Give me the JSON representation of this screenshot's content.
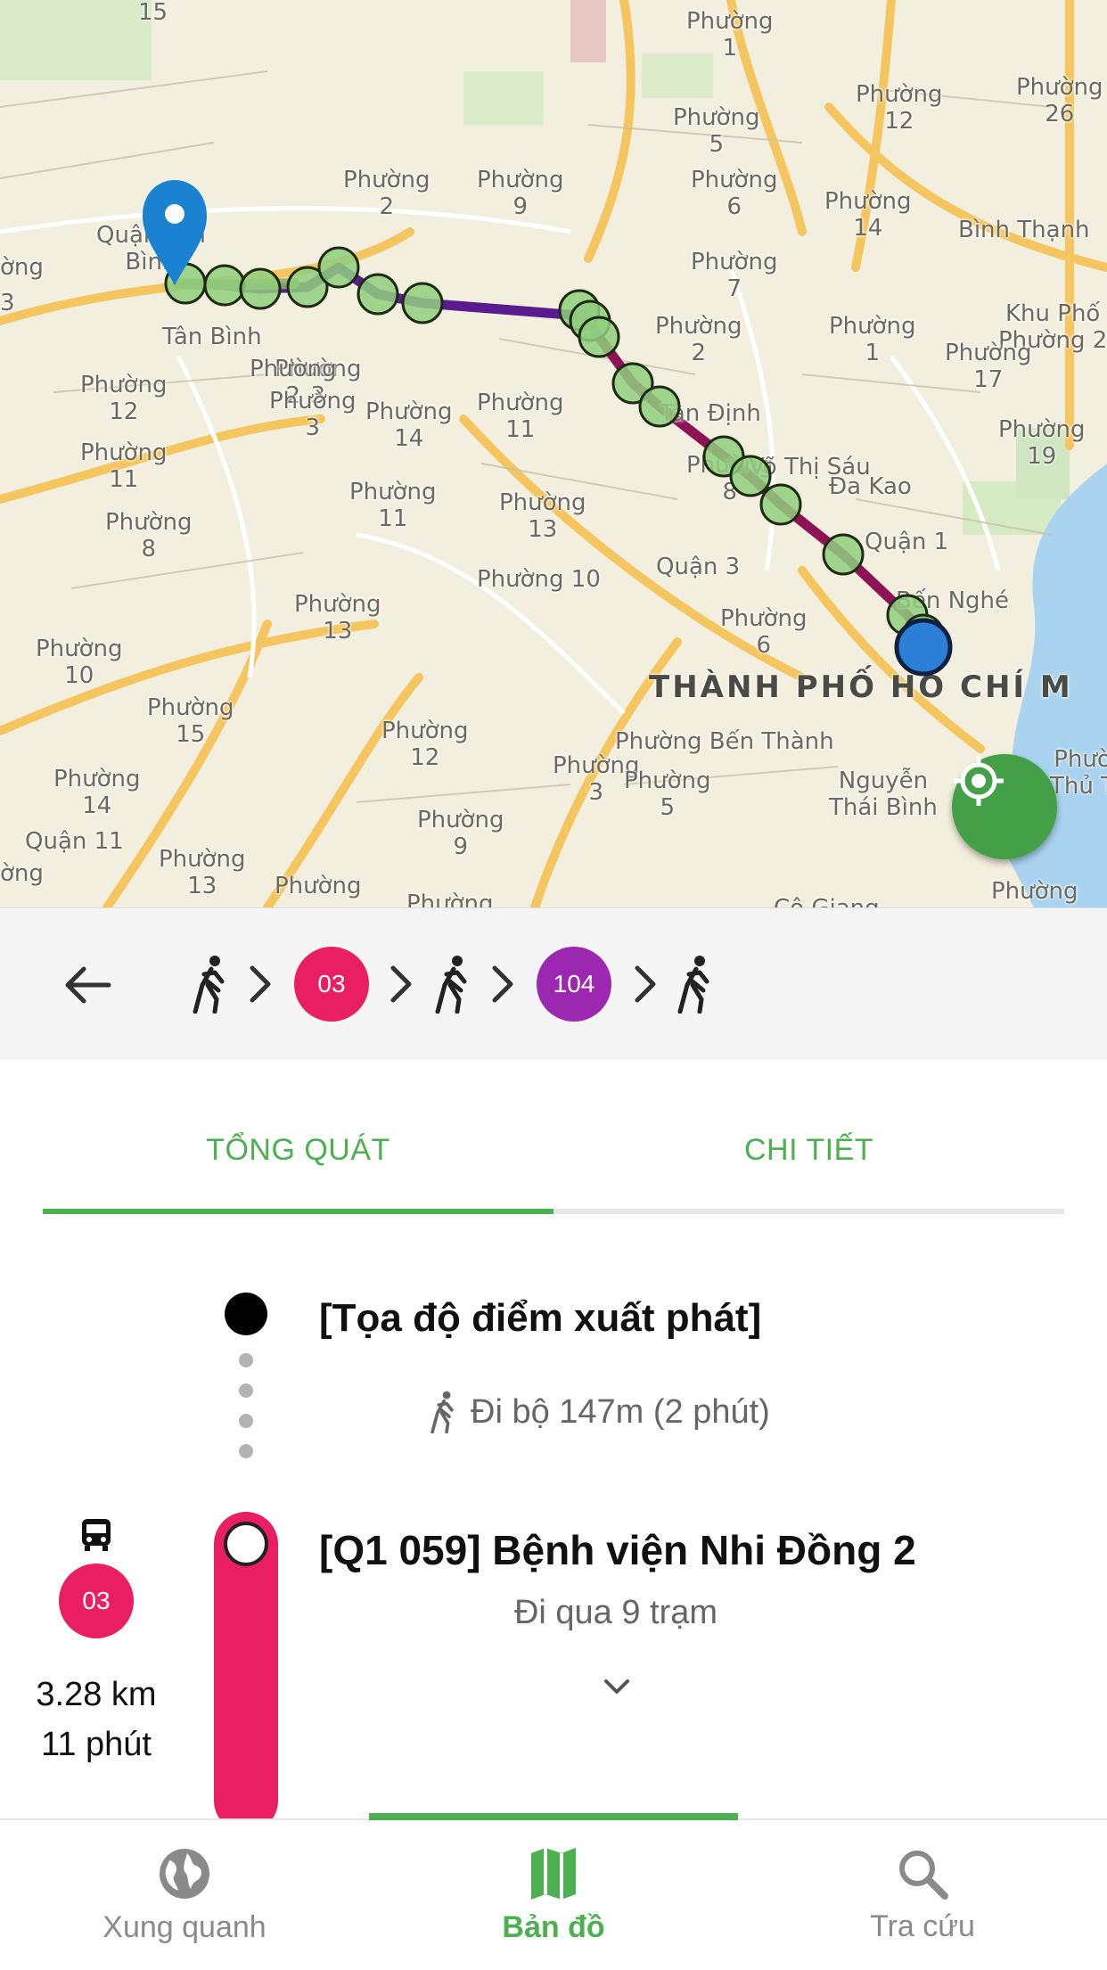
{
  "map": {
    "labels": [
      "15",
      "Phường\n1",
      "Phường\n12",
      "Phường\n26",
      "Phường\n5",
      "Phường\n2",
      "Phường\n9",
      "Phường\n6",
      "Phường\n14",
      "Bình Thạnh",
      "Quận Tân\nBình",
      "ờng",
      "3",
      "Tân Bình",
      "Phường\n3",
      "Phường\n7",
      "Khu Phố\nPhường 2",
      "Phường\n2",
      "Phường\n1",
      "Phường\n17",
      "Phường\n12",
      "Phường\n2",
      "Phường\n3",
      "Phường\n14",
      "Phường\n11",
      "Tân Định",
      "Phường\n19",
      "Phường\n11",
      "Phường\n8",
      "Phường\n11",
      "Phường\n13",
      "Phường\n8",
      "Đa Kao",
      "Quận 1",
      "Võ Thị Sáu",
      "Quận 3",
      "Phường\n13",
      "Phường 10",
      "Bến Nghé",
      "Phường\n6",
      "Phường\n10",
      "Phường\n15",
      "Phường\n12",
      "Phường\n3",
      "Phường Bến Thành",
      "Phường\n14",
      "Phường\n5",
      "Nguyễn\nThái Bình",
      "Phườ\nThủ T",
      "Quận 11",
      "Phường\n13",
      "Phường\n9",
      "Phường",
      "Phường",
      "Phường",
      "ờng",
      "Cô Giang"
    ],
    "city_label": "THÀNH PHỐ HỒ CHÍ M",
    "colors": {
      "bus_03": "#8e1256",
      "bus_104": "#5a1b8f",
      "stop": "#8fcf7f",
      "pin": "#1b82d1",
      "destination": "#2b7fd6"
    }
  },
  "route_bar": {
    "back_icon": "arrow-left-icon",
    "steps": [
      {
        "type": "walk"
      },
      {
        "type": "bus",
        "label": "03",
        "color": "#e91e63"
      },
      {
        "type": "walk"
      },
      {
        "type": "bus",
        "label": "104",
        "color": "#9c27b0"
      },
      {
        "type": "walk"
      }
    ]
  },
  "tabs": [
    {
      "label": "TỔNG QUÁT",
      "active": true
    },
    {
      "label": "CHI TIẾT",
      "active": false
    }
  ],
  "timeline": {
    "start_title": "[Tọa độ điểm xuất phát]",
    "walk_text": "Đi bộ 147m (2 phút)",
    "stop_title": "[Q1 059] Bệnh viện Nhi Đồng 2",
    "stop_subtitle": "Đi qua 9 trạm",
    "bus_label": "03",
    "bus_color": "#e91e63",
    "distance": "3.28 km",
    "duration": "11 phút"
  },
  "bottom_nav": [
    {
      "label": "Xung quanh",
      "icon": "globe-icon",
      "active": false
    },
    {
      "label": "Bản đồ",
      "icon": "map-icon",
      "active": true
    },
    {
      "label": "Tra cứu",
      "icon": "search-icon",
      "active": false
    }
  ],
  "accent_color": "#4caf50"
}
